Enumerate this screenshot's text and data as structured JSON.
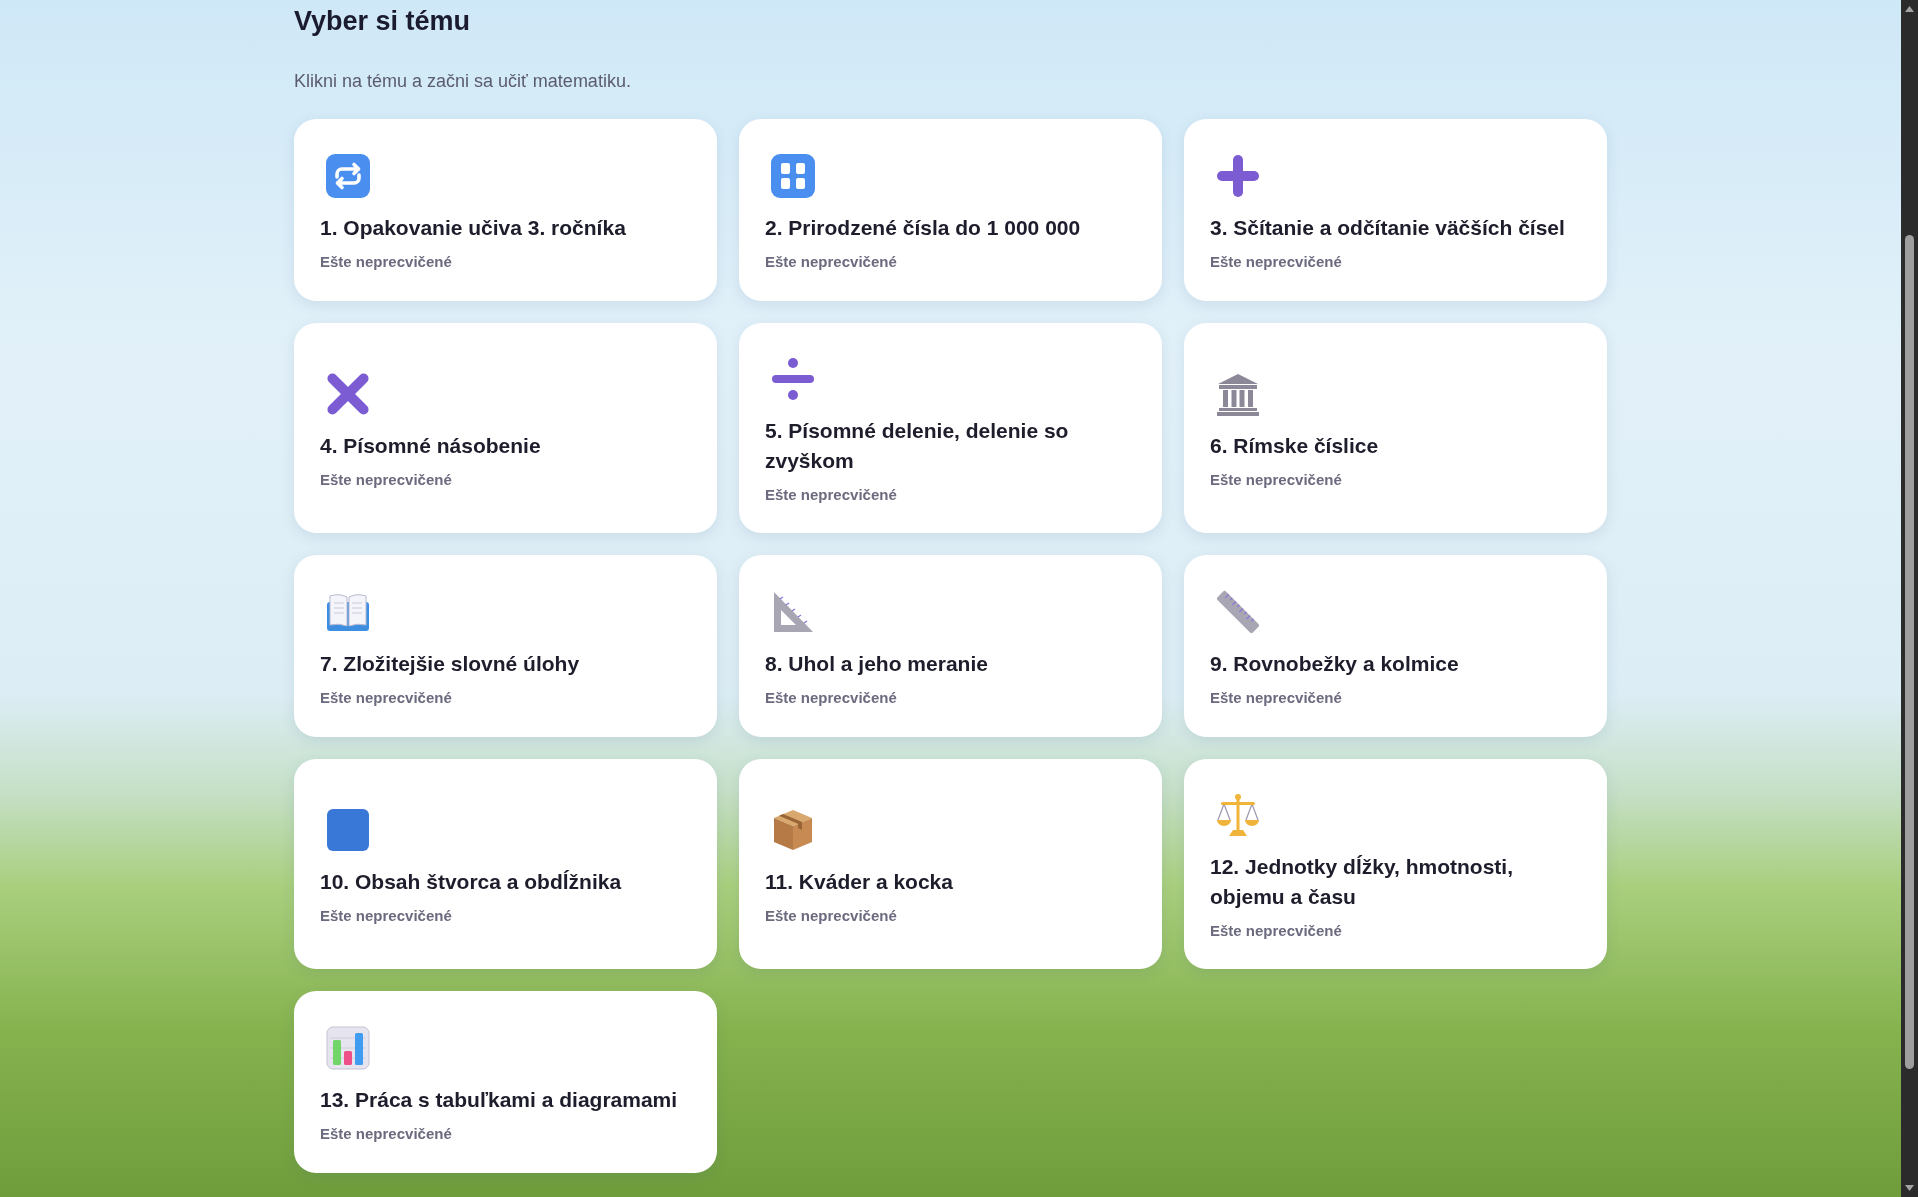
{
  "header": {
    "title": "Vyber si tému",
    "subtitle": "Klikni na tému a začni sa učiť matematiku."
  },
  "topics": [
    {
      "title": "1. Opakovanie učiva 3. ročníka",
      "status": "Ešte neprecvičené"
    },
    {
      "title": "2. Prirodzené čísla do 1 000 000",
      "status": "Ešte neprecvičené"
    },
    {
      "title": "3. Sčítanie a odčítanie väčších čísel",
      "status": "Ešte neprecvičené"
    },
    {
      "title": "4. Písomné násobenie",
      "status": "Ešte neprecvičené"
    },
    {
      "title": "5. Písomné delenie, delenie so zvyškom",
      "status": "Ešte neprecvičené"
    },
    {
      "title": "6. Rímske číslice",
      "status": "Ešte neprecvičené"
    },
    {
      "title": "7. Zložitejšie slovné úlohy",
      "status": "Ešte neprecvičené"
    },
    {
      "title": "8. Uhol a jeho meranie",
      "status": "Ešte neprecvičené"
    },
    {
      "title": "9. Rovnobežky a kolmice",
      "status": "Ešte neprecvičené"
    },
    {
      "title": "10. Obsah štvorca a obdĺžnika",
      "status": "Ešte neprecvičené"
    },
    {
      "title": "11. Kváder a kocka",
      "status": "Ešte neprecvičené"
    },
    {
      "title": "12. Jednotky dĺžky, hmotnosti, objemu a času",
      "status": "Ešte neprecvičené"
    },
    {
      "title": "13. Práca s tabuľkami a diagramami",
      "status": "Ešte neprecvičené"
    }
  ]
}
